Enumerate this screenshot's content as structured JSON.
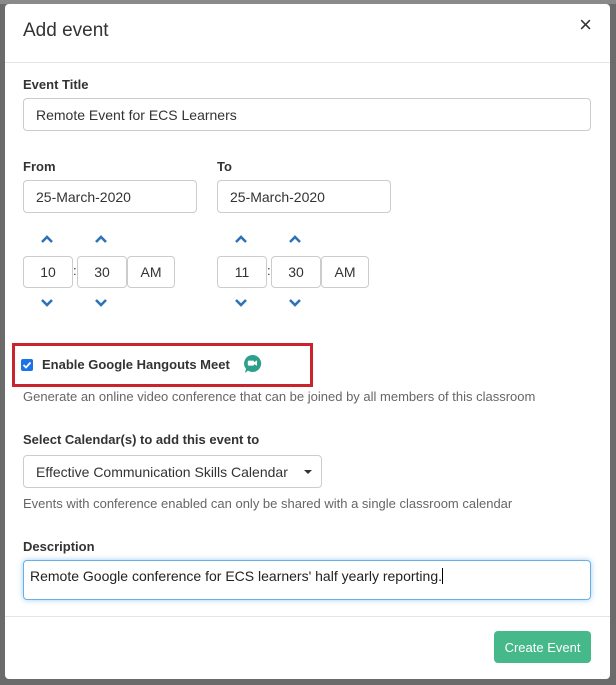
{
  "modal": {
    "title": "Add event",
    "close_symbol": "×"
  },
  "event_title": {
    "label": "Event Title",
    "value": "Remote Event for ECS Learners"
  },
  "from": {
    "label": "From",
    "date": "25-March-2020",
    "hour": "10",
    "minute": "30",
    "ampm": "AM"
  },
  "to": {
    "label": "To",
    "date": "25-March-2020",
    "hour": "11",
    "minute": "30",
    "ampm": "AM"
  },
  "time_separator": ":",
  "hangouts": {
    "checked": true,
    "label": "Enable Google Hangouts Meet",
    "icon": "google-meet-icon",
    "help": "Generate an online video conference that can be joined by all members of this classroom"
  },
  "calendar": {
    "label": "Select Calendar(s) to add this event to",
    "selected": "Effective Communication Skills Calendar",
    "help": "Events with conference enabled can only be shared with a single classroom calendar"
  },
  "description": {
    "label": "Description",
    "value": "Remote Google conference for ECS learners' half yearly reporting."
  },
  "footer": {
    "create_label": "Create Event"
  },
  "colors": {
    "accent_blue": "#2e74b5",
    "checkbox_blue": "#1a73e8",
    "highlight_red": "#c9232d",
    "create_green": "#46b98a",
    "meet_green": "#2d9f8a"
  }
}
